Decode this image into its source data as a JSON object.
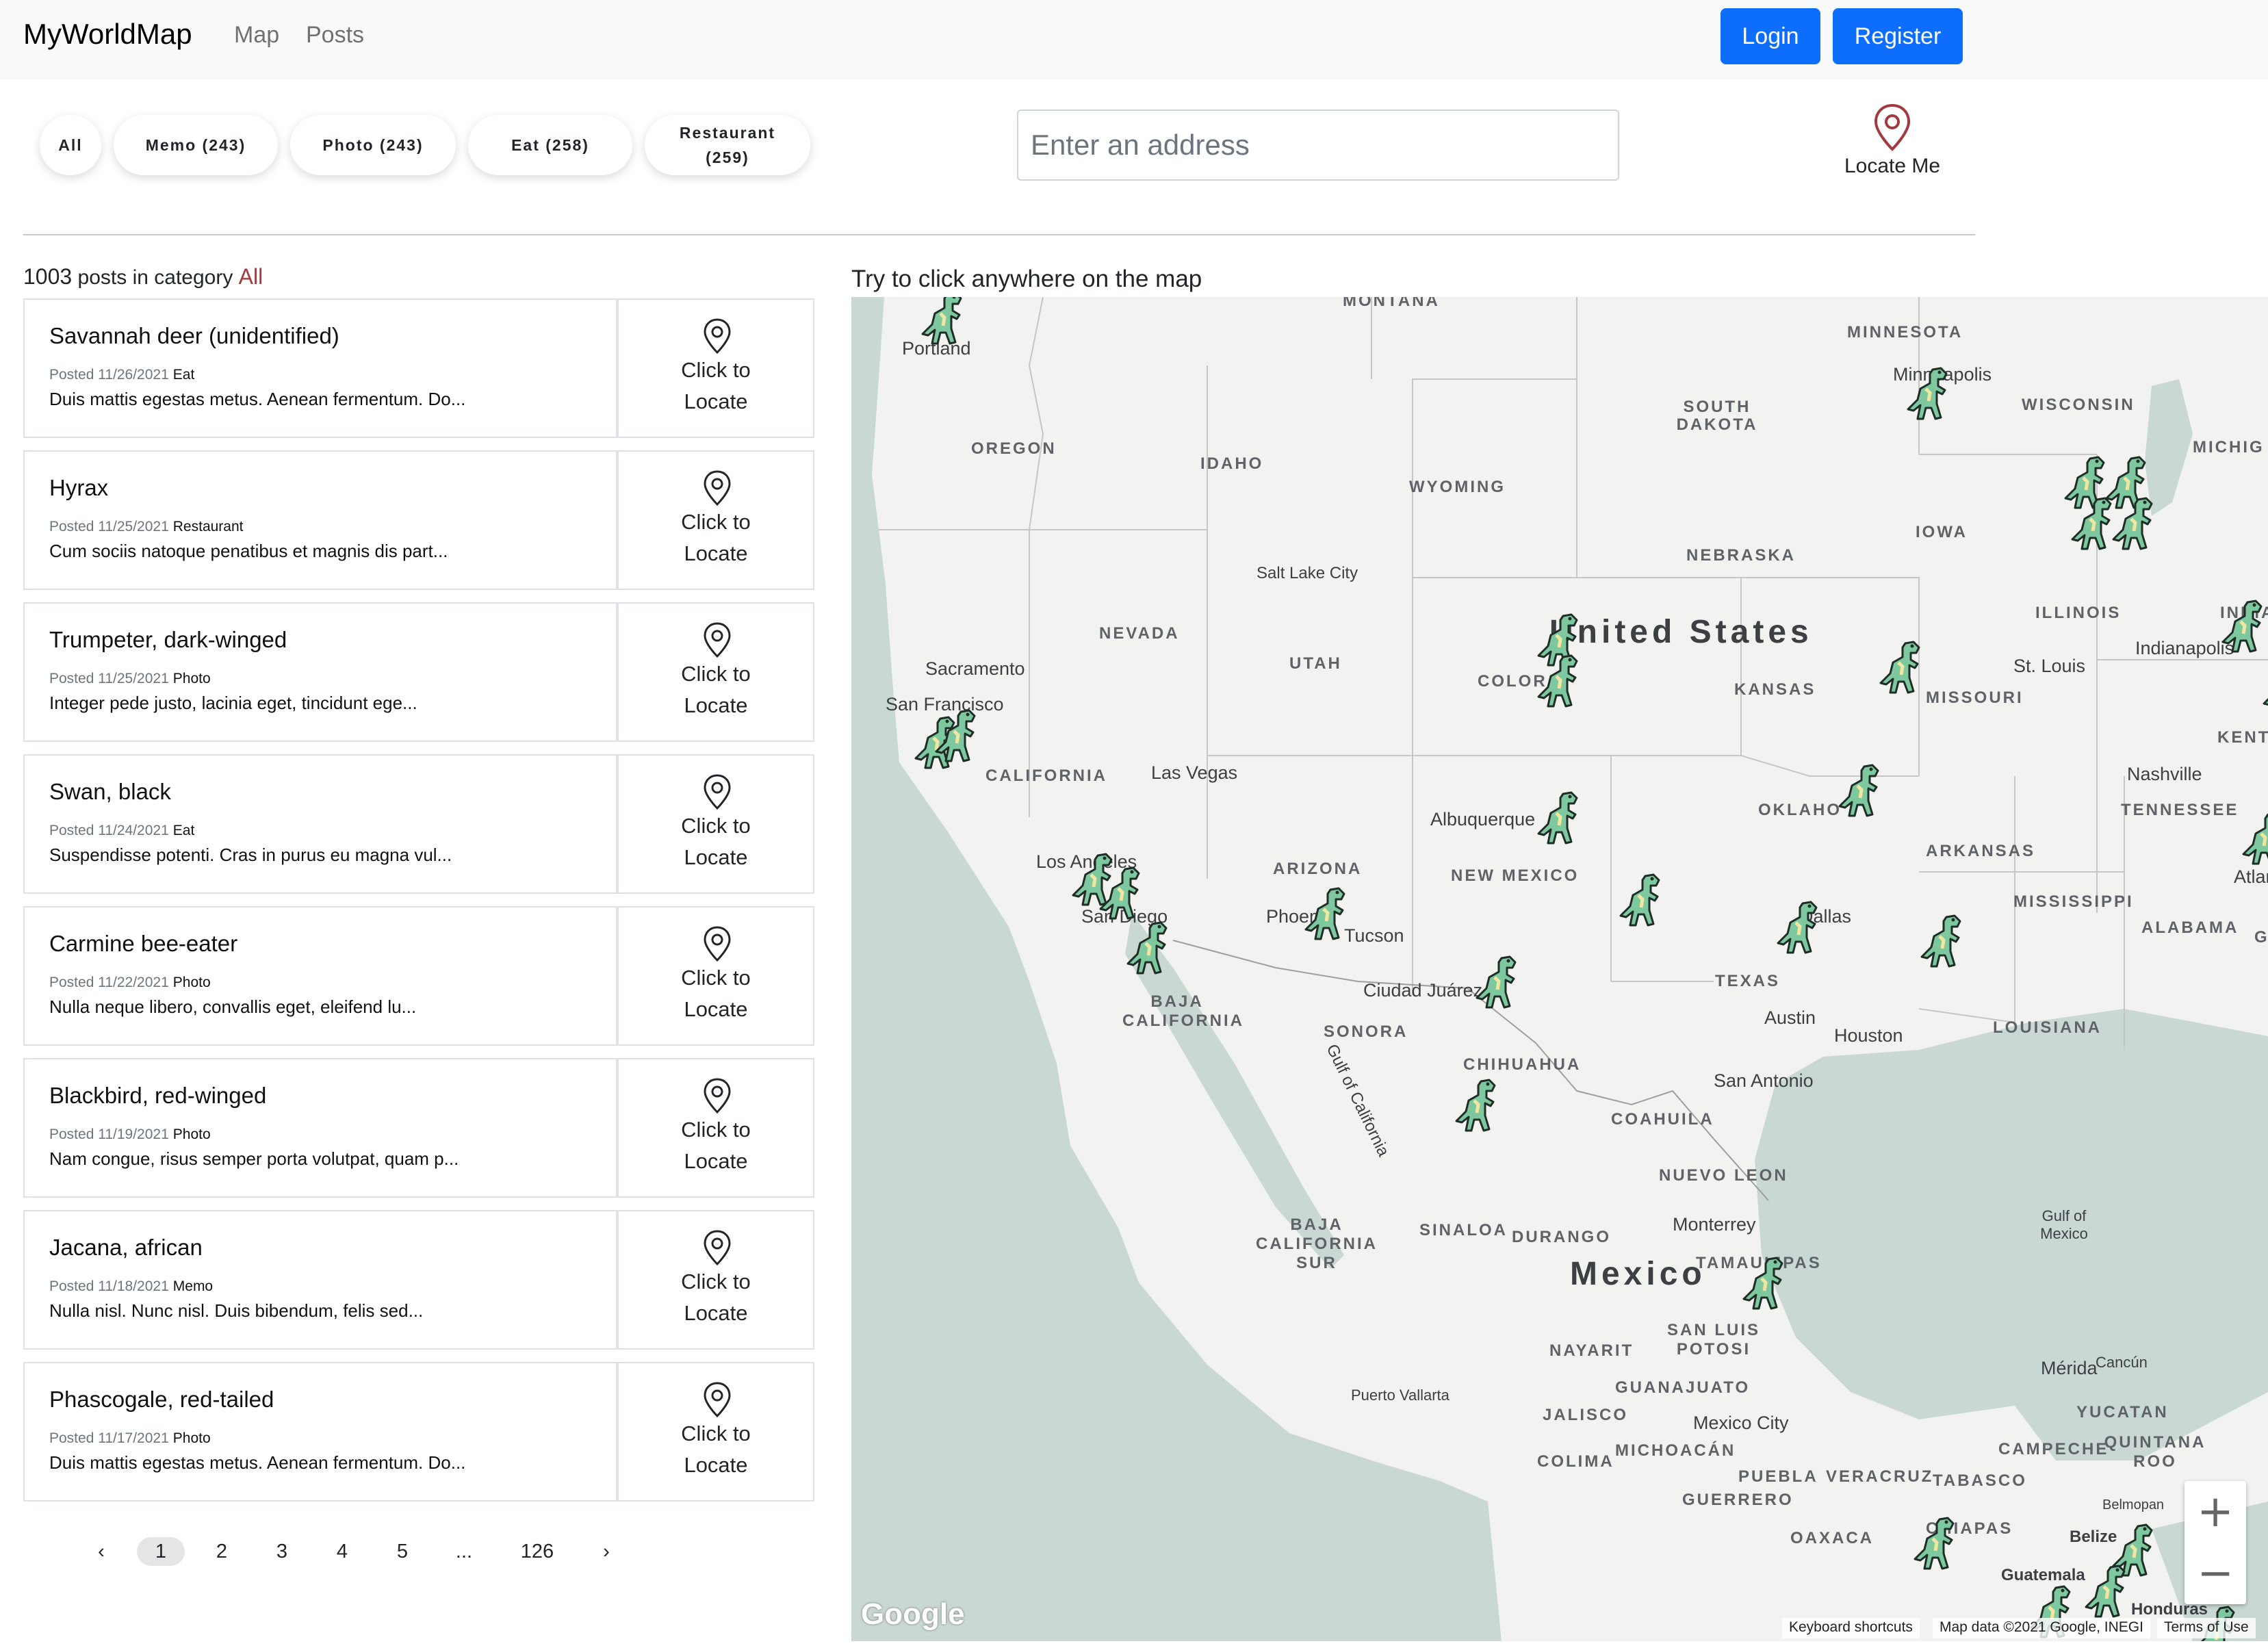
{
  "navbar": {
    "brand": "MyWorldMap",
    "links": [
      "Map",
      "Posts"
    ],
    "login": "Login",
    "register": "Register"
  },
  "filters": [
    {
      "label": "All"
    },
    {
      "label": "Memo (243)"
    },
    {
      "label": "Photo (243)"
    },
    {
      "label": "Eat (258)"
    },
    {
      "label": "Restaurant (259)"
    }
  ],
  "search": {
    "placeholder": "Enter an address"
  },
  "locate_me": "Locate Me",
  "summary": {
    "count": "1003",
    "text": "posts in category",
    "category": "All"
  },
  "map_hint": "Try to click anywhere on the map",
  "locate_label_1": "Click to",
  "locate_label_2": "Locate",
  "posts": [
    {
      "title": "Savannah deer (unidentified)",
      "posted": "Posted 11/26/2021",
      "category": "Eat",
      "desc": "Duis mattis egestas metus. Aenean fermentum. Do..."
    },
    {
      "title": "Hyrax",
      "posted": "Posted 11/25/2021",
      "category": "Restaurant",
      "desc": "Cum sociis natoque penatibus et magnis dis part..."
    },
    {
      "title": "Trumpeter, dark-winged",
      "posted": "Posted 11/25/2021",
      "category": "Photo",
      "desc": "Integer pede justo, lacinia eget, tincidunt ege..."
    },
    {
      "title": "Swan, black",
      "posted": "Posted 11/24/2021",
      "category": "Eat",
      "desc": "Suspendisse potenti. Cras in purus eu magna vul..."
    },
    {
      "title": "Carmine bee-eater",
      "posted": "Posted 11/22/2021",
      "category": "Photo",
      "desc": "Nulla neque libero, convallis eget, eleifend lu..."
    },
    {
      "title": "Blackbird, red-winged",
      "posted": "Posted 11/19/2021",
      "category": "Photo",
      "desc": "Nam congue, risus semper porta volutpat, quam p..."
    },
    {
      "title": "Jacana, african",
      "posted": "Posted 11/18/2021",
      "category": "Memo",
      "desc": "Nulla nisl. Nunc nisl. Duis bibendum, felis sed..."
    },
    {
      "title": "Phascogale, red-tailed",
      "posted": "Posted 11/17/2021",
      "category": "Photo",
      "desc": "Duis mattis egestas metus. Aenean fermentum. Do..."
    }
  ],
  "pagination": {
    "prev": "‹",
    "pages": [
      "1",
      "2",
      "3",
      "4",
      "5",
      "...",
      "126"
    ],
    "next": "›",
    "current": "1"
  },
  "map": {
    "countries": [
      "United States",
      "Mexico"
    ],
    "states": [
      "MONTANA",
      "MINNESOTA",
      "SOUTH DAKOTA",
      "WISCONSIN",
      "MICHIG",
      "OREGON",
      "IDAHO",
      "WYOMING",
      "IOWA",
      "NEBRASKA",
      "NEVADA",
      "UTAH",
      "COLORA",
      "ILLINOIS",
      "INDIA",
      "KANSAS",
      "MISSOURI",
      "KENTUC",
      "CALIFORNIA",
      "TENNESSEE",
      "OKLAHO",
      "ARKANSAS",
      "ARIZONA",
      "NEW MEXICO",
      "MISSISSIPPI",
      "ALABAMA",
      "G",
      "TEXAS",
      "LOUISIANA",
      "BAJA CALIFORNIA",
      "SONORA",
      "CHIHUAHUA",
      "COAHUILA",
      "NUEVO LEON",
      "BAJA CALIFORNIA SUR",
      "SINALOA",
      "DURANGO",
      "TAMAULIPAS",
      "SAN LUIS POTOSI",
      "NAYARIT",
      "GUANAJUATO",
      "JALISCO",
      "MICHOACÁN",
      "COLIMA",
      "PUEBLA",
      "VERACRUZ",
      "TABASCO",
      "GUERRERO",
      "OAXACA",
      "CHIAPAS",
      "YUCATAN",
      "CAMPECHE",
      "QUINTANA ROO"
    ],
    "cities": [
      "Portland",
      "Minneapolis",
      "Salt Lake City",
      "Sacramento",
      "San Francisco",
      "Las Vegas",
      "Los Angeles",
      "San Diego",
      "Phoenix",
      "Tucson",
      "Albuquerque",
      "Ciudad Juárez",
      "St. Louis",
      "Indianapolis",
      "Nashville",
      "Atlanta",
      "Dallas",
      "Austin",
      "Houston",
      "San Antonio",
      "Monterrey",
      "Puerto Vallarta",
      "Mexico City",
      "Mérida",
      "Cancún",
      "Belmopan",
      "Belize",
      "Guatemala",
      "Honduras"
    ],
    "water": [
      "Gulf of California",
      "Gulf of Mexico"
    ],
    "zoom_in": "+",
    "zoom_out": "−",
    "logo": "Google",
    "attribution": [
      "Keyboard shortcuts",
      "Map data ©2021 Google, INEGI",
      "Terms of Use"
    ],
    "colors": {
      "water": "#cad8d4",
      "land": "#f2f2f0",
      "border": "#bdbdbd",
      "dino_body": "#7ec8a0",
      "dino_outline": "#1f2d26"
    }
  }
}
